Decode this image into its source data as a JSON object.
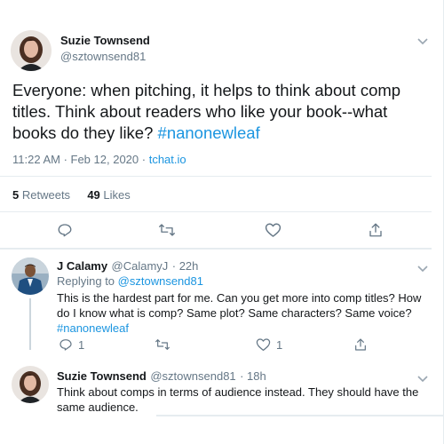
{
  "main_tweet": {
    "author_name": "Suzie Townsend",
    "handle": "@sztownsend81",
    "text_plain": "Everyone: when pitching, it helps to think about comp titles. Think about readers who like your book--what books do they like?",
    "hashtag": "#nanonewleaf",
    "time": "11:22 AM · Feb 12, 2020",
    "separator": " · ",
    "source": "tchat.io",
    "retweets_count": "5",
    "retweets_label": "Retweets",
    "likes_count": "49",
    "likes_label": "Likes"
  },
  "reply1": {
    "author_name": "J Calamy",
    "handle": "@CalamyJ",
    "time": "· 22h",
    "replying_label": "Replying to",
    "replying_to": "@sztownsend81",
    "text": "This is the hardest part for me. Can you get more into comp titles? How do I know what is comp? Same plot? Same characters? Same voice?",
    "hashtag": "#nanonewleaf",
    "reply_count": "1",
    "like_count": "1"
  },
  "reply2": {
    "author_name": "Suzie Townsend",
    "handle": "@sztownsend81",
    "time": "· 18h",
    "text": "Think about comps in terms of audience instead. They should have the same audience."
  },
  "colors": {
    "link": "#1b95e0",
    "secondary": "#657786",
    "divider": "#e6ecf0"
  },
  "icons": [
    "chevron-down-icon",
    "reply-icon",
    "retweet-icon",
    "like-icon",
    "share-icon"
  ]
}
